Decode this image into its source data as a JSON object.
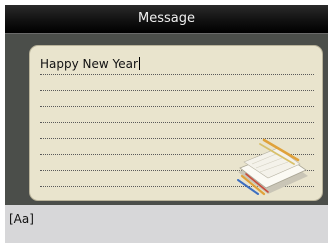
{
  "window": {
    "title": "Message"
  },
  "message": {
    "text": "Happy New Year"
  },
  "input_bar": {
    "mode_label": "[Aa]"
  },
  "colors": {
    "title_bar": "#000000",
    "frame": "#4b4e4a",
    "note_paper": "#e9e4cd",
    "input_bar": "#d7d7d9"
  },
  "icons": {
    "decoration": "stationery-pencils-icon"
  }
}
